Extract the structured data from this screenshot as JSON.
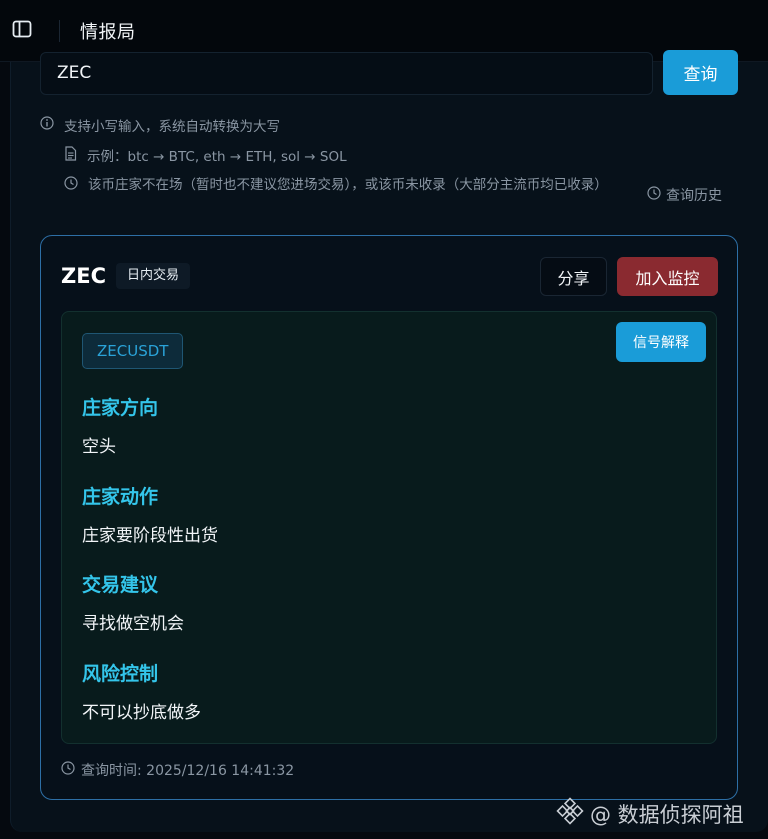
{
  "app": {
    "title": "情报局"
  },
  "search": {
    "value": "ZEC",
    "button_label": "查询"
  },
  "hints": {
    "lowercase": "支持小写输入，系统自动转换为大写",
    "example": "示例：btc → BTC, eth → ETH, sol → SOL",
    "warning": "该币庄家不在场（暂时也不建议您进场交易），或该币未收录（大部分主流币均已收录）",
    "history_label": "查询历史"
  },
  "card": {
    "symbol": "ZEC",
    "tag": "日内交易",
    "share_label": "分享",
    "monitor_label": "加入监控",
    "pair": "ZECUSDT",
    "explain_label": "信号解释",
    "sections": [
      {
        "title": "庄家方向",
        "value": "空头"
      },
      {
        "title": "庄家动作",
        "value": "庄家要阶段性出货"
      },
      {
        "title": "交易建议",
        "value": "寻找做空机会"
      },
      {
        "title": "风险控制",
        "value": "不可以抄底做多"
      }
    ],
    "query_time": "查询时间: 2025/12/16 14:41:32"
  },
  "watermark": {
    "text": "@ 数据侦探阿祖"
  },
  "colors": {
    "accent": "#1a9cd8",
    "danger": "#8a2a30",
    "section_title": "#34c5ea",
    "card_border": "#2d6fa6"
  },
  "icons": {
    "sidebar_toggle": "sidebar-toggle-icon",
    "info": "info-icon",
    "document": "document-icon",
    "clock": "clock-icon",
    "binance_logo": "binance-logo-icon"
  }
}
